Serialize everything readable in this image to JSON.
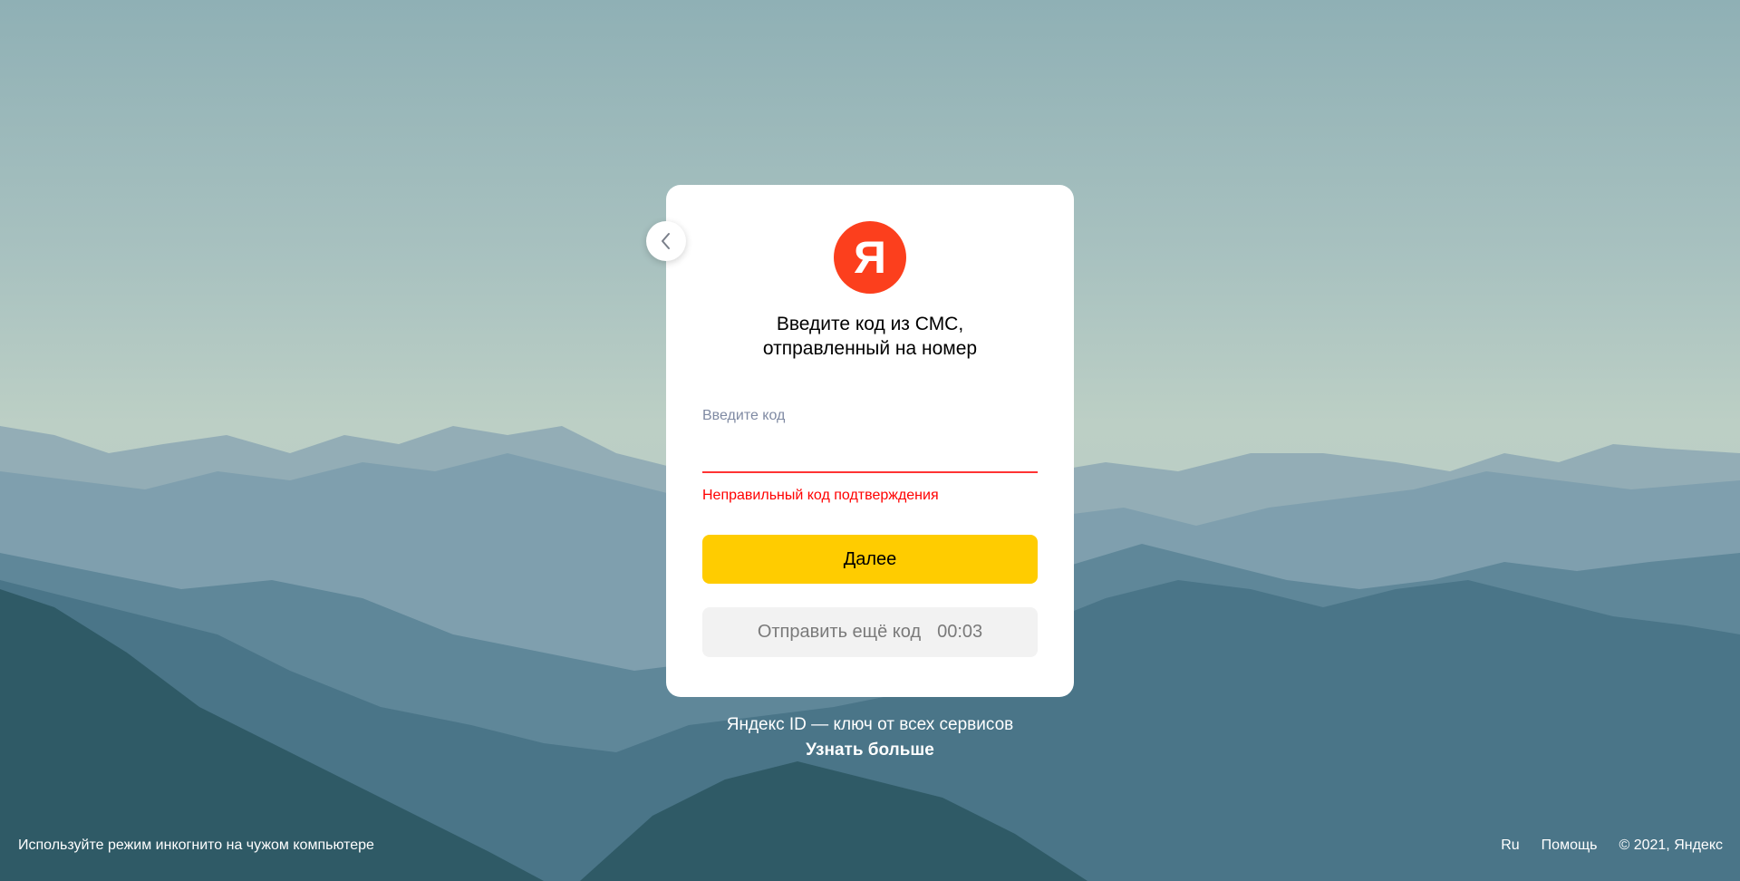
{
  "brand": {
    "logo_letter": "Я",
    "logo_color": "#fc3f1d"
  },
  "auth_card": {
    "title_line1": "Введите код из СМС,",
    "title_line2": "отправленный на номер",
    "code_label": "Введите код",
    "code_value": "",
    "error_message": "Неправильный код подтверждения",
    "next_button": "Далее",
    "resend_button": "Отправить ещё код",
    "resend_timer": "00:03",
    "back_icon": "chevron-left-icon"
  },
  "promo": {
    "text": "Яндекс ID — ключ от всех сервисов",
    "link": "Узнать больше"
  },
  "footer": {
    "incognito_hint": "Используйте режим инкогнито на чужом компьютере",
    "language": "Ru",
    "help": "Помощь",
    "copyright": "© 2021, Яндекс"
  },
  "colors": {
    "accent_yellow": "#ffcc00",
    "error_red": "#ff0000",
    "brand_red": "#fc3f1d"
  }
}
